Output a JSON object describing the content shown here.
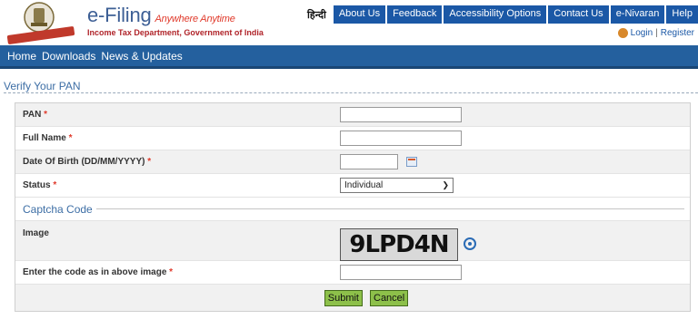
{
  "header": {
    "brand_name": "e-Filing",
    "brand_tagline": "Anywhere Anytime",
    "department": "Income Tax Department, Government of India",
    "language": "हिन्दी",
    "top_nav": [
      "About Us",
      "Feedback",
      "Accessibility Options",
      "Contact Us",
      "e-Nivaran",
      "Help"
    ],
    "login": "Login",
    "separator": "|",
    "register": "Register"
  },
  "main_nav": [
    "Home",
    "Downloads",
    "News & Updates"
  ],
  "section_title": "Verify Your PAN",
  "form": {
    "required_mark": "*",
    "pan_label": "PAN",
    "full_name_label": "Full Name",
    "dob_label": "Date Of Birth (DD/MM/YYYY)",
    "status_label": "Status",
    "status_value": "Individual",
    "captcha_heading": "Captcha Code",
    "image_label": "Image",
    "captcha_text": "9LPD4N",
    "code_label": "Enter the code as in above image"
  },
  "buttons": {
    "submit": "Submit",
    "cancel": "Cancel"
  },
  "colors": {
    "nav_blue": "#24609e",
    "top_nav_blue": "#1b58a6",
    "button_green": "#8dc04a",
    "required_red": "#e03a2b"
  },
  "icons": [
    "emblem-icon",
    "user-icon",
    "calendar-icon",
    "refresh-icon",
    "chevron-down-icon"
  ]
}
